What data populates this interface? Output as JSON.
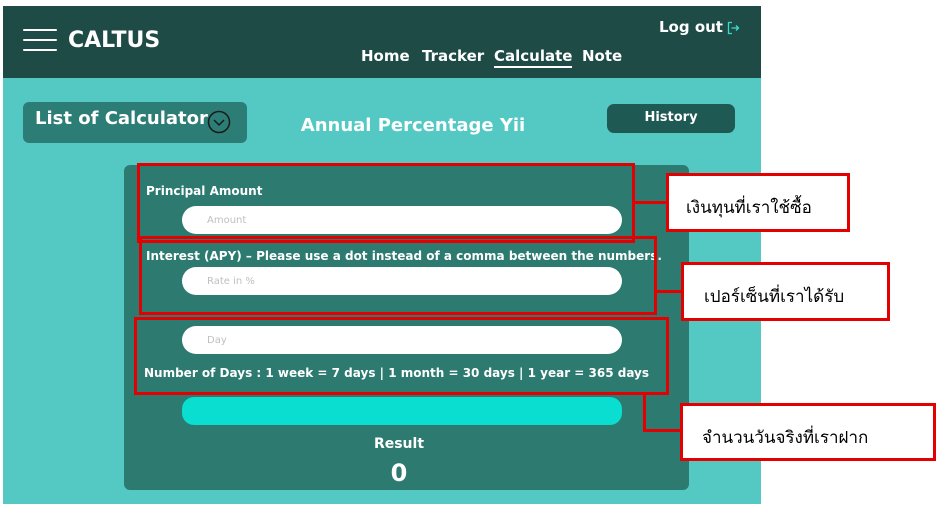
{
  "header": {
    "logo": "CALTUS",
    "nav": [
      "Home",
      "Tracker",
      "Calculate",
      "Note"
    ],
    "active_nav": "Calculate",
    "logout_label": "Log out"
  },
  "toolbar": {
    "list_label": "List of Calculator",
    "title": "Annual Percentage Yii",
    "history_label": "History"
  },
  "form": {
    "principal": {
      "label": "Principal Amount",
      "placeholder": "Amount",
      "value": ""
    },
    "interest": {
      "label": "Interest (APY) – Please use a dot instead of a comma between the numbers.",
      "placeholder": "Rate in %",
      "value": ""
    },
    "days": {
      "placeholder": "Day",
      "value": "",
      "note": "Number of Days : 1 week = 7 days | 1 month = 30 days | 1 year = 365 days"
    },
    "result_label": "Result",
    "result_value": "0"
  },
  "annotations": [
    "เงินทุนที่เราใช้ซื้อ",
    "เปอร์เซ็นที่เราได้รับ",
    "จำนวนวันจริงที่เราฝาก"
  ],
  "colors": {
    "header_bg": "#1f4b47",
    "page_bg": "#54c9c3",
    "card_bg": "#2c7a70",
    "button_accent": "#09ded0",
    "annotation_red": "#e30000"
  },
  "icons": {
    "menu": "hamburger-icon",
    "logout": "logout-icon",
    "dropdown": "chevron-down-circle-icon"
  }
}
